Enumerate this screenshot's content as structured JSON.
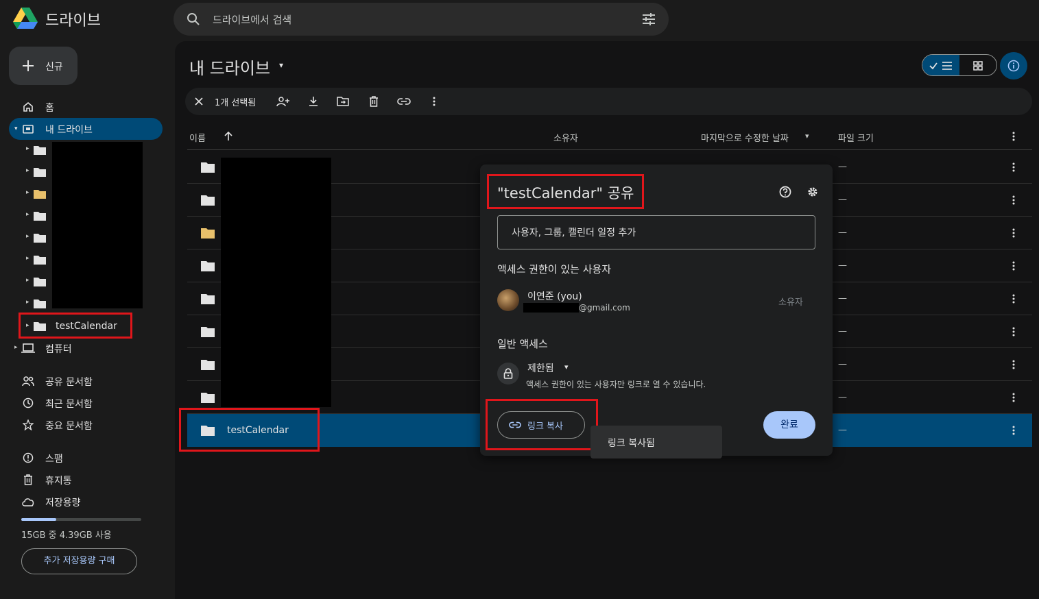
{
  "app": {
    "title": "드라이브"
  },
  "search": {
    "placeholder": "드라이브에서 검색"
  },
  "sidebar": {
    "new_label": "신규",
    "items": [
      {
        "label": "홈"
      },
      {
        "label": "내 드라이브"
      },
      {
        "label": "컴퓨터"
      },
      {
        "label": "공유 문서함"
      },
      {
        "label": "최근 문서함"
      },
      {
        "label": "중요 문서함"
      },
      {
        "label": "스팸"
      },
      {
        "label": "휴지통"
      },
      {
        "label": "저장용량"
      }
    ],
    "tree_selected_label": "testCalendar",
    "storage_text": "15GB 중 4.39GB 사용",
    "storage_used_fraction": 0.29,
    "buy_storage_label": "추가 저장용량 구매"
  },
  "main": {
    "title": "내 드라이브",
    "selection_count": "1개 선택됨",
    "columns": {
      "name": "이름",
      "owner": "소유자",
      "modified": "마지막으로 수정한 날짜",
      "size": "파일 크기"
    },
    "rows": [
      {
        "size": "—"
      },
      {
        "size": "—"
      },
      {
        "size": "—"
      },
      {
        "size": "—"
      },
      {
        "size": "—"
      },
      {
        "size": "—"
      },
      {
        "size": "—"
      },
      {
        "size": "—"
      },
      {
        "name": "testCalendar",
        "size": "—"
      }
    ]
  },
  "dialog": {
    "title": "\"testCalendar\" 공유",
    "add_placeholder": "사용자, 그룹, 캘린더 일정 추가",
    "access_heading": "액세스 권한이 있는 사용자",
    "user_name": "이연준 (you)",
    "user_email": "@gmail.com",
    "user_role": "소유자",
    "general_heading": "일반 액세스",
    "restriction": "제한됨",
    "restriction_desc": "액세스 권한이 있는 사용자만 링크로 열 수 있습니다.",
    "copy_link_label": "링크 복사",
    "done_label": "완료"
  },
  "toast": {
    "text": "링크 복사됨"
  }
}
